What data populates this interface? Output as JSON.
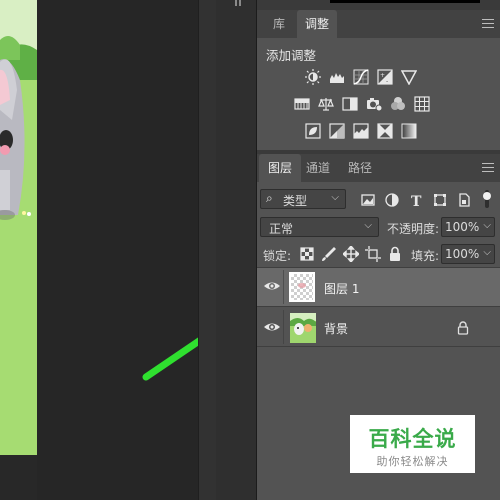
{
  "adjustments_panel": {
    "tabs": [
      {
        "label": "库"
      },
      {
        "label": "调整"
      }
    ],
    "active_tab": "调整",
    "heading": "添加调整",
    "icons_row1": [
      "brightness-contrast-icon",
      "levels-icon",
      "curves-icon",
      "exposure-icon",
      "vibrance-icon"
    ],
    "icons_row2": [
      "hue-saturation-icon",
      "color-balance-icon",
      "black-white-icon",
      "photo-filter-icon",
      "channel-mixer-icon",
      "color-lookup-icon"
    ],
    "icons_row3": [
      "invert-icon",
      "posterize-icon",
      "threshold-icon",
      "selective-color-icon",
      "gradient-map-icon"
    ]
  },
  "layers_panel": {
    "tabs": [
      {
        "label": "图层"
      },
      {
        "label": "通道"
      },
      {
        "label": "路径"
      }
    ],
    "active_tab": "图层",
    "filter": {
      "label": "类型"
    },
    "blend_mode": "正常",
    "opacity": {
      "label": "不透明度:",
      "value": "100%"
    },
    "lock": {
      "label": "锁定:"
    },
    "fill": {
      "label": "填充:",
      "value": "100%"
    },
    "layers": [
      {
        "name": "图层 1",
        "visible": true,
        "selected": true
      },
      {
        "name": "背景",
        "visible": true,
        "locked": true
      }
    ]
  },
  "watermark": {
    "title": "百科全说",
    "subtitle": "助你轻松解决"
  },
  "colors": {
    "panel_bg": "#535353",
    "selected_row": "#696969",
    "arrow": "#2fe02f",
    "watermark_green": "#3aaa4a"
  }
}
